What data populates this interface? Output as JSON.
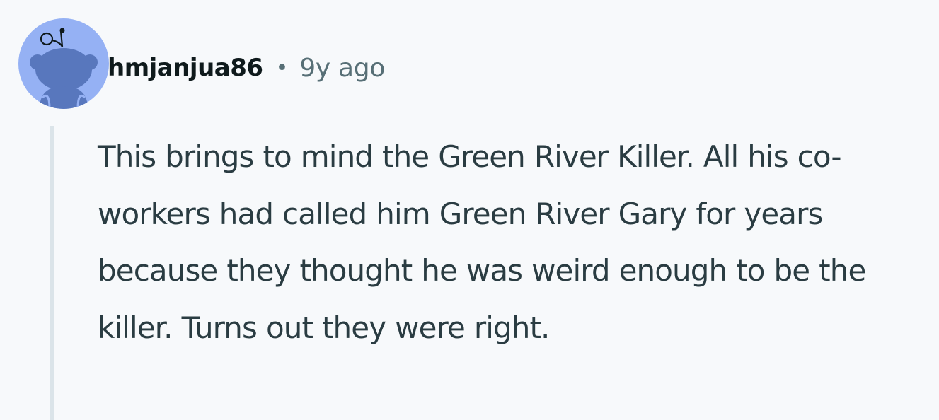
{
  "comment": {
    "author": "hmjanjua86",
    "separator": "•",
    "age": "9y ago",
    "avatar_icon": "reddit-snoo-default-avatar-icon",
    "body": "This brings to mind the Green River Killer. All his co-workers had called him Green River Gary for years because they thought he was weird enough to be the killer. Turns out they were right."
  },
  "colors": {
    "background": "#f7f9fb",
    "avatar_bg": "#95b1f4",
    "avatar_figure": "#5877bd",
    "username": "#0f1a1c",
    "meta": "#576f76",
    "body_text": "#2a3c42",
    "thread_line": "#dbe4e9"
  }
}
